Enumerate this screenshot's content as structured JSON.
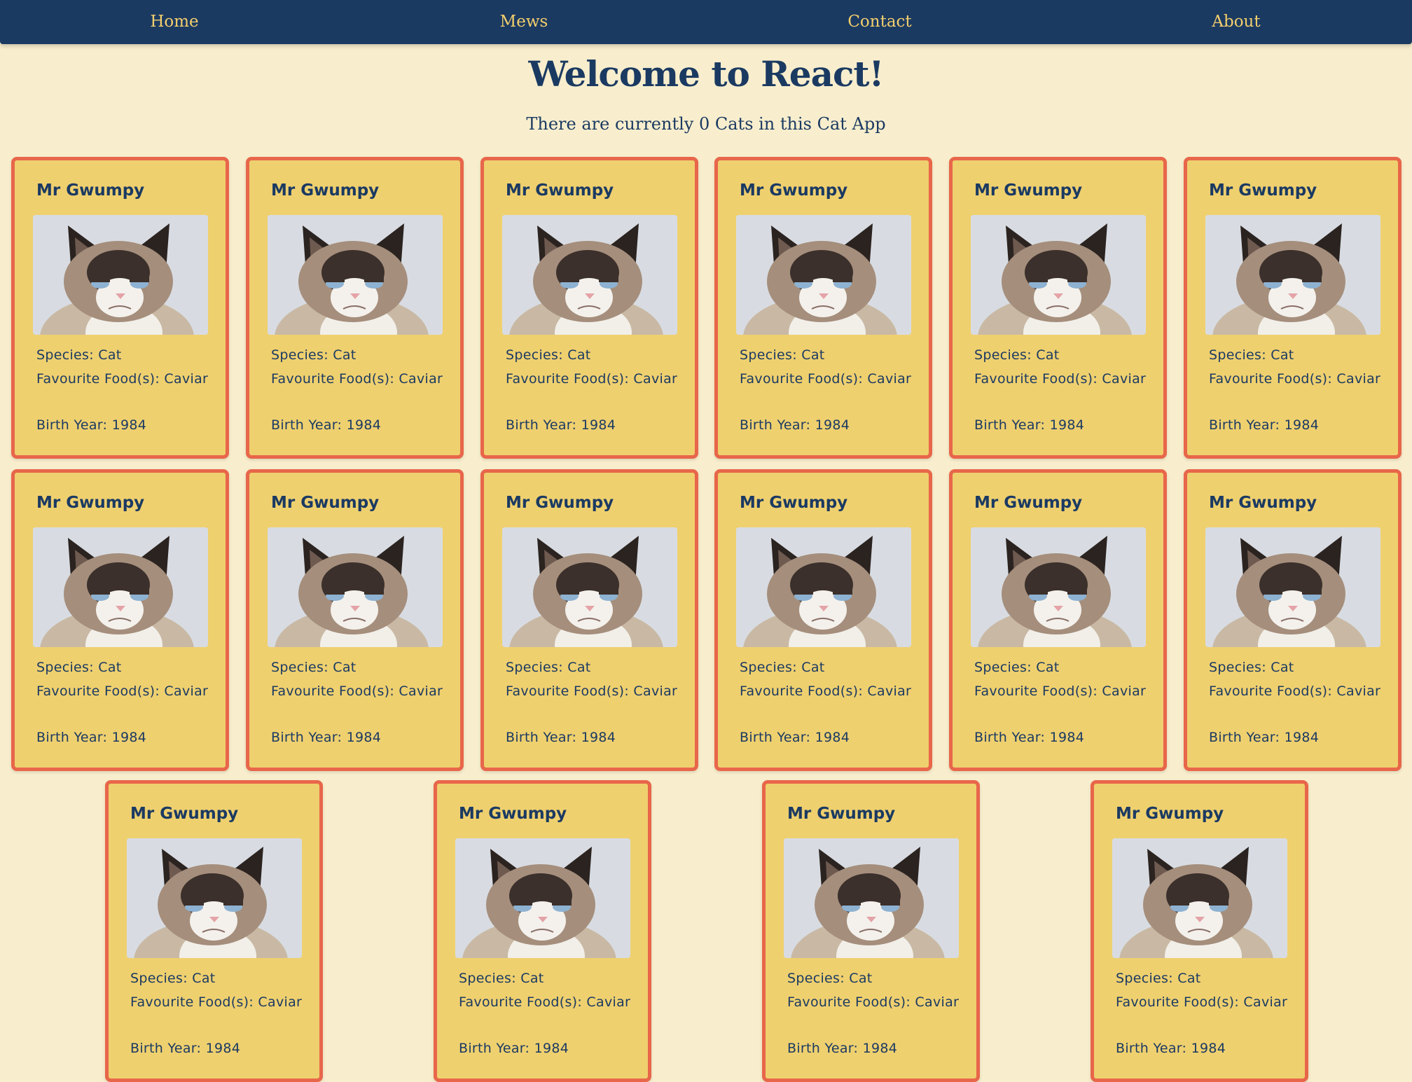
{
  "nav": {
    "items": [
      "Home",
      "Mews",
      "Contact",
      "About"
    ]
  },
  "header": {
    "title": "Welcome to React!",
    "subtitle": "There are currently 0 Cats in this Cat App"
  },
  "cat": {
    "name": "Mr Gwumpy",
    "species": "Species: Cat",
    "food": "Favourite Food(s): Caviar",
    "birth_year": "Birth Year: 1984",
    "photo_icon": "grumpy-cat-photo"
  },
  "cards_visible": 16,
  "colors": {
    "background": "#f8eecd",
    "navbar": "#1b3a62",
    "nav_text": "#f3cf6c",
    "card": "#efd06f",
    "card_border": "#e8664a",
    "text": "#1b3a62"
  }
}
